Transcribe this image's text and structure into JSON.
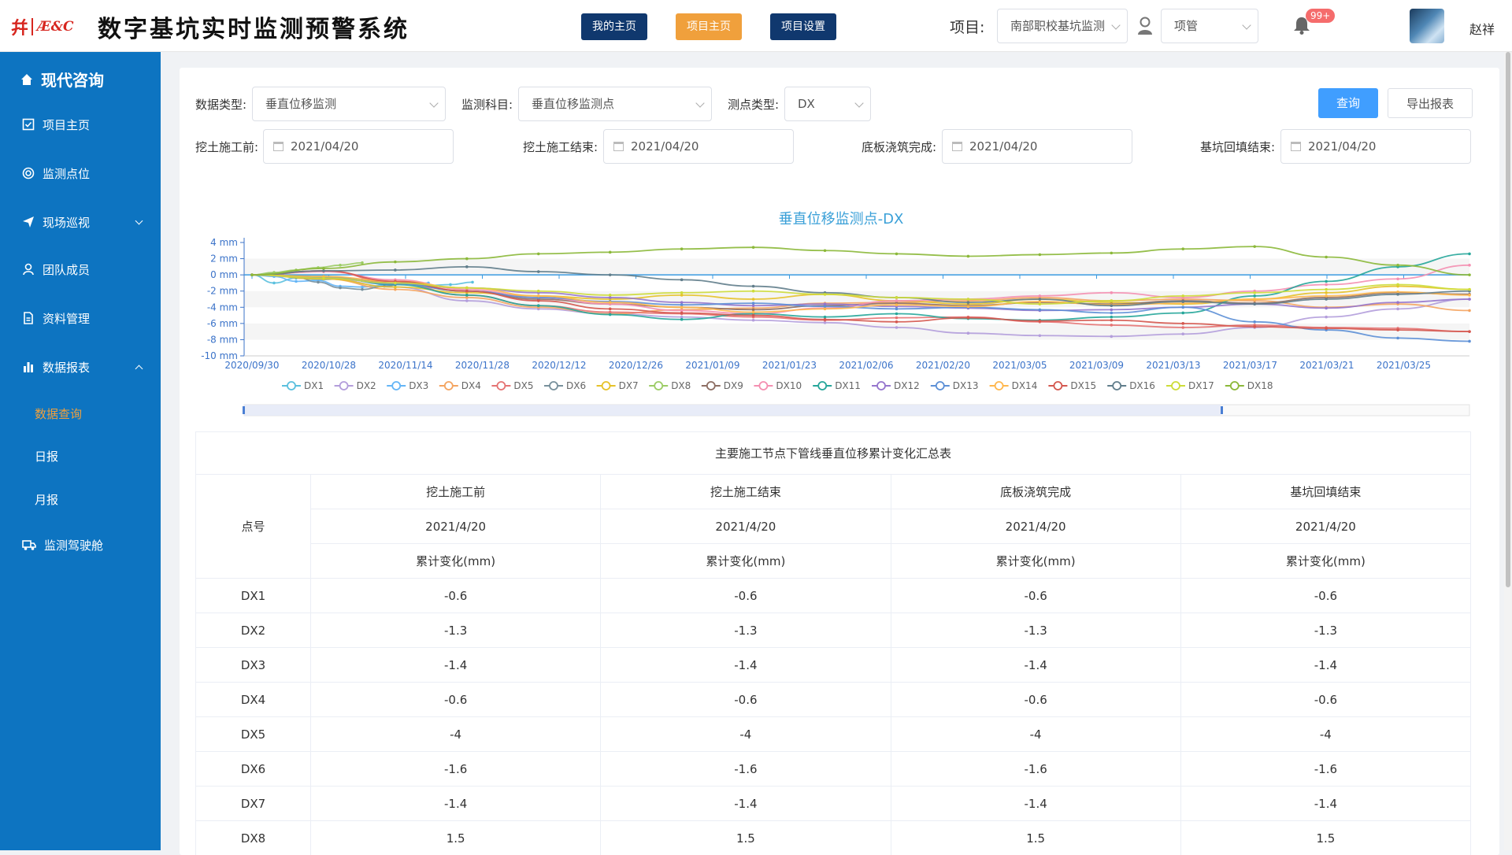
{
  "header": {
    "logo_mark": "幷",
    "logo_sub": "Æ&C",
    "system_title": "数字基坑实时监测预警系统",
    "buttons": [
      "我的主页",
      "项目主页",
      "项目设置"
    ],
    "project_label": "项目:",
    "project_value": "南部职校基坑监测",
    "role_value": "项管",
    "notif_badge": "99+",
    "user_name": "赵祥"
  },
  "sidebar": {
    "brand": "现代咨询",
    "items": [
      {
        "label": "项目主页",
        "icon": "check-square-icon"
      },
      {
        "label": "监测点位",
        "icon": "target-icon"
      },
      {
        "label": "现场巡视",
        "icon": "send-icon"
      },
      {
        "label": "团队成员",
        "icon": "person-icon"
      },
      {
        "label": "资料管理",
        "icon": "document-icon"
      },
      {
        "label": "数据报表",
        "icon": "bar-chart-icon"
      },
      {
        "label": "监测驾驶舱",
        "icon": "truck-icon"
      }
    ],
    "subitems": [
      "数据查询",
      "日报",
      "月报"
    ]
  },
  "filters": {
    "data_type_label": "数据类型:",
    "data_type_value": "垂直位移监测",
    "subject_label": "监测科目:",
    "subject_value": "垂直位移监测点",
    "point_type_label": "测点类型:",
    "point_type_value": "DX",
    "query_button": "查询",
    "export_button": "导出报表",
    "dates": [
      {
        "label": "挖土施工前:",
        "value": "2021/04/20"
      },
      {
        "label": "挖土施工结束:",
        "value": "2021/04/20"
      },
      {
        "label": "底板浇筑完成:",
        "value": "2021/04/20"
      },
      {
        "label": "基坑回填结束:",
        "value": "2021/04/20"
      }
    ]
  },
  "chart_data": {
    "type": "line",
    "title": "垂直位移监测点-DX",
    "y_tick_labels": [
      "4 mm",
      "2 mm",
      "0 mm",
      "-2 mm",
      "-4 mm",
      "-6 mm",
      "-8 mm",
      "-10 mm"
    ],
    "ylim": [
      -10,
      4
    ],
    "x_tick_labels": [
      "2020/09/30",
      "2020/10/28",
      "2020/11/14",
      "2020/11/28",
      "2020/12/12",
      "2020/12/26",
      "2021/01/09",
      "2021/01/23",
      "2021/02/06",
      "2021/02/20",
      "2021/03/05",
      "2021/03/09",
      "2021/03/13",
      "2021/03/17",
      "2021/03/21",
      "2021/03/25"
    ],
    "legend_position": "bottom",
    "series": [
      {
        "name": "DX1",
        "color": "#5bc0de",
        "values": [
          0,
          -1.0,
          -0.4,
          -0.6,
          -0.5,
          -0.7,
          -1.2,
          -1.0,
          -1.3,
          -1.2,
          -0.9
        ]
      },
      {
        "name": "DX2",
        "color": "#b39ddb",
        "values": [
          0,
          -0.4,
          -1.5,
          -3.2,
          -4.2,
          -4.8,
          -5.2,
          -5.6,
          -5.9,
          -6.5,
          -7.2,
          -7.5,
          -7.6,
          -7.3,
          -6.5,
          -5.2,
          -4.2,
          -3.0
        ]
      },
      {
        "name": "DX3",
        "color": "#64b5f6",
        "values": [
          0,
          -0.2,
          -0.8,
          -0.7,
          -1.4,
          -1.5,
          -1.3,
          -1.1,
          -1.0
        ]
      },
      {
        "name": "DX4",
        "color": "#f4a460",
        "values": [
          0,
          -0.5,
          -1.8,
          -2.8,
          -4.0,
          -4.8,
          -4.3,
          -4.1,
          -3.5,
          -3.4,
          -3.2,
          -2.8,
          -3.2,
          -3.0,
          -3.2,
          -4.0,
          -3.6,
          -4.4
        ]
      },
      {
        "name": "DX5",
        "color": "#e57373",
        "values": [
          0,
          0.5,
          -1.0,
          -2.5,
          -3.8,
          -4.6,
          -4.8,
          -5.2,
          -5.6,
          -5.3,
          -5.2,
          -5.8,
          -6.2,
          -6.5,
          -6.2,
          -6.5,
          -6.6,
          -7.0
        ]
      },
      {
        "name": "DX6",
        "color": "#78909c",
        "values": [
          0,
          0.2,
          -0.3,
          -0.9,
          -1.6,
          -1.8,
          -1.4,
          -1.0
        ]
      },
      {
        "name": "DX7",
        "color": "#e6c229",
        "values": [
          0,
          -0.5,
          -1.5,
          -2.2,
          -2.6,
          -3.0,
          -2.5,
          -3.0,
          -2.4,
          -3.2,
          -3.6,
          -3.0,
          -3.4,
          -3.6,
          -3.0,
          -2.2,
          -1.4,
          -1.8
        ]
      },
      {
        "name": "DX8",
        "color": "#9ccc65",
        "values": [
          0,
          0.3,
          0.6,
          0.9,
          1.2,
          1.5
        ]
      },
      {
        "name": "DX9",
        "color": "#8d6e63",
        "values": [
          0,
          -0.3,
          -1.0,
          -2.0,
          -3.0,
          -3.6,
          -4.0,
          -4.3,
          -3.8,
          -3.5,
          -3.8,
          -3.4,
          -3.6,
          -3.2,
          -3.5,
          -2.8,
          -2.2,
          -2.4
        ]
      },
      {
        "name": "DX10",
        "color": "#f48fb1",
        "values": [
          0,
          0.4,
          -0.6,
          -1.8,
          -2.8,
          -3.6,
          -4.4,
          -4.8,
          -4.1,
          -3.2,
          -3.0,
          -2.6,
          -2.2,
          -2.8,
          -2.0,
          -1.2,
          -0.5,
          1.2
        ]
      },
      {
        "name": "DX11",
        "color": "#26a69a",
        "values": [
          0,
          -0.2,
          -1.2,
          -2.5,
          -3.8,
          -4.9,
          -5.5,
          -4.8,
          -5.2,
          -4.8,
          -5.4,
          -5.6,
          -5.2,
          -4.7,
          -2.6,
          -0.8,
          1.0,
          2.6
        ]
      },
      {
        "name": "DX12",
        "color": "#9575cd",
        "values": [
          0,
          -0.4,
          -1.0,
          -1.6,
          -2.2,
          -2.8,
          -3.4,
          -3.8,
          -3.6,
          -3.9,
          -4.1,
          -4.4,
          -4.3,
          -4.0,
          -3.6,
          -4.1,
          -3.4,
          -3.0
        ]
      },
      {
        "name": "DX13",
        "color": "#5c8fd6",
        "values": [
          0,
          -0.3,
          -1.1,
          -2.0,
          -2.8,
          -3.3,
          -3.7,
          -3.5,
          -3.9,
          -4.2,
          -4.0,
          -4.3,
          -4.7,
          -4.0,
          -5.8,
          -6.8,
          -7.8,
          -8.2
        ]
      },
      {
        "name": "DX14",
        "color": "#ffb74d",
        "values": [
          0,
          -0.2,
          -0.8,
          -1.6,
          -2.6,
          -3.4,
          -4.0,
          -4.6,
          -4.2,
          -3.7,
          -3.9,
          -3.3,
          -3.7,
          -3.5,
          -3.0,
          -2.6,
          -2.1,
          -2.5
        ]
      },
      {
        "name": "DX15",
        "color": "#d4574e",
        "values": [
          0,
          0.5,
          -0.8,
          -2.0,
          -3.2,
          -4.2,
          -4.7,
          -5.0,
          -5.5,
          -5.8,
          -5.3,
          -5.7,
          -5.6,
          -6.0,
          -6.4,
          -6.6,
          -6.8,
          -7.0
        ]
      },
      {
        "name": "DX16",
        "color": "#607d8b",
        "values": [
          0,
          0.5,
          0.6,
          1.0,
          0.4,
          0.0,
          -0.6,
          -1.4,
          -2.2,
          -2.8,
          -3.4,
          -3.0,
          -3.8,
          -3.3,
          -3.6,
          -3.0,
          -2.4,
          -2.0
        ]
      },
      {
        "name": "DX17",
        "color": "#cddc39",
        "values": [
          0,
          -0.4,
          -1.0,
          -1.6,
          -2.0,
          -2.5,
          -2.2,
          -2.0,
          -2.4,
          -2.8,
          -3.0,
          -3.6,
          -3.2,
          -2.6,
          -2.2,
          -1.8,
          -1.2,
          -1.8
        ]
      },
      {
        "name": "DX18",
        "color": "#8bb839",
        "values": [
          0,
          0.8,
          1.6,
          2.0,
          2.6,
          2.8,
          3.2,
          3.4,
          3.0,
          2.6,
          2.3,
          2.5,
          2.7,
          3.2,
          3.5,
          2.2,
          1.2,
          0.0
        ]
      }
    ]
  },
  "table": {
    "caption": "主要施工节点下管线垂直位移累计变化汇总表",
    "point_header": "点号",
    "stages": [
      "挖土施工前",
      "挖土施工结束",
      "底板浇筑完成",
      "基坑回填结束"
    ],
    "stage_dates": [
      "2021/4/20",
      "2021/4/20",
      "2021/4/20",
      "2021/4/20"
    ],
    "unit_label": "累计变化(mm)",
    "rows": [
      {
        "point": "DX1",
        "values": [
          "-0.6",
          "-0.6",
          "-0.6",
          "-0.6"
        ]
      },
      {
        "point": "DX2",
        "values": [
          "-1.3",
          "-1.3",
          "-1.3",
          "-1.3"
        ]
      },
      {
        "point": "DX3",
        "values": [
          "-1.4",
          "-1.4",
          "-1.4",
          "-1.4"
        ]
      },
      {
        "point": "DX4",
        "values": [
          "-0.6",
          "-0.6",
          "-0.6",
          "-0.6"
        ]
      },
      {
        "point": "DX5",
        "values": [
          "-4",
          "-4",
          "-4",
          "-4"
        ]
      },
      {
        "point": "DX6",
        "values": [
          "-1.6",
          "-1.6",
          "-1.6",
          "-1.6"
        ]
      },
      {
        "point": "DX7",
        "values": [
          "-1.4",
          "-1.4",
          "-1.4",
          "-1.4"
        ]
      },
      {
        "point": "DX8",
        "values": [
          "1.5",
          "1.5",
          "1.5",
          "1.5"
        ]
      }
    ]
  }
}
